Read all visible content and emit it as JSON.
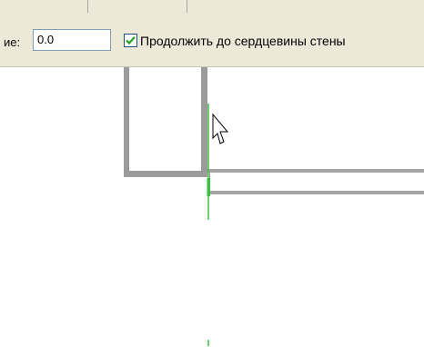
{
  "options_bar": {
    "field_label": "ие:",
    "field_value": "0.0",
    "checkbox_checked": true,
    "checkbox_label": "Продолжить до сердцевины стены"
  },
  "colors": {
    "toolbar_bg": "#ece9d8",
    "wall_gray": "#9b9b9b",
    "guide_green": "#3fbf3f",
    "checkbox_check": "#21a121"
  },
  "icons": [
    "checkmark-icon",
    "mouse-pointer-icon"
  ]
}
